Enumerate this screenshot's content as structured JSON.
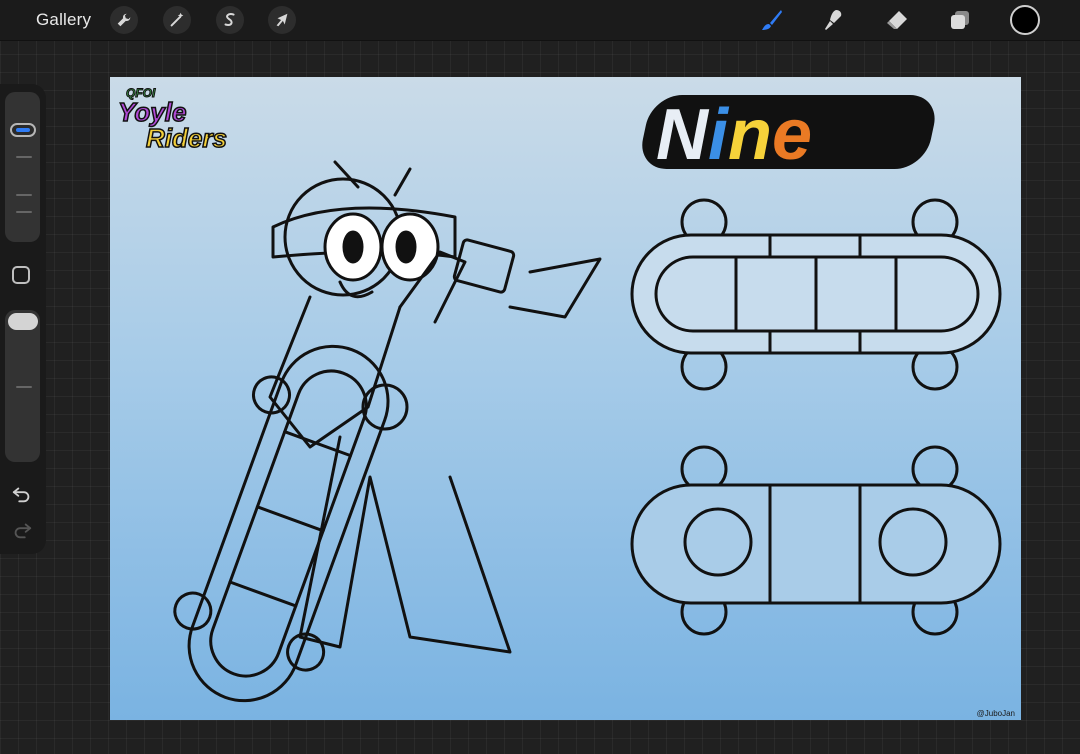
{
  "toolbar": {
    "gallery_label": "Gallery",
    "actions_icon": "wrench-icon",
    "adjustments_icon": "magic-wand-icon",
    "selection_icon": "selection-s-icon",
    "transform_icon": "arrow-cursor-icon",
    "brush_icon": "brush-icon",
    "smudge_icon": "smudge-icon",
    "eraser_icon": "eraser-icon",
    "layers_icon": "layers-icon",
    "current_color": "#000000",
    "active_tool_color": "#2f7cf6"
  },
  "sidebar": {
    "brush_size_level": 0.23,
    "opacity_level": 0.02,
    "undo_icon": "undo-icon",
    "redo_icon": "redo-icon",
    "modify_icon": "square-icon"
  },
  "canvas": {
    "brand_logo_text_top": "QFOI",
    "brand_logo_text_line1": "Yoyle",
    "brand_logo_text_line2": "Riders",
    "title_text": "Nine",
    "title_colors": [
      "#e8eef5",
      "#3b8fe6",
      "#f6d23a",
      "#ea7a24"
    ],
    "credit": "@JuboJan",
    "background_top": "#cadbe8",
    "background_bottom": "#7ab3e2"
  }
}
